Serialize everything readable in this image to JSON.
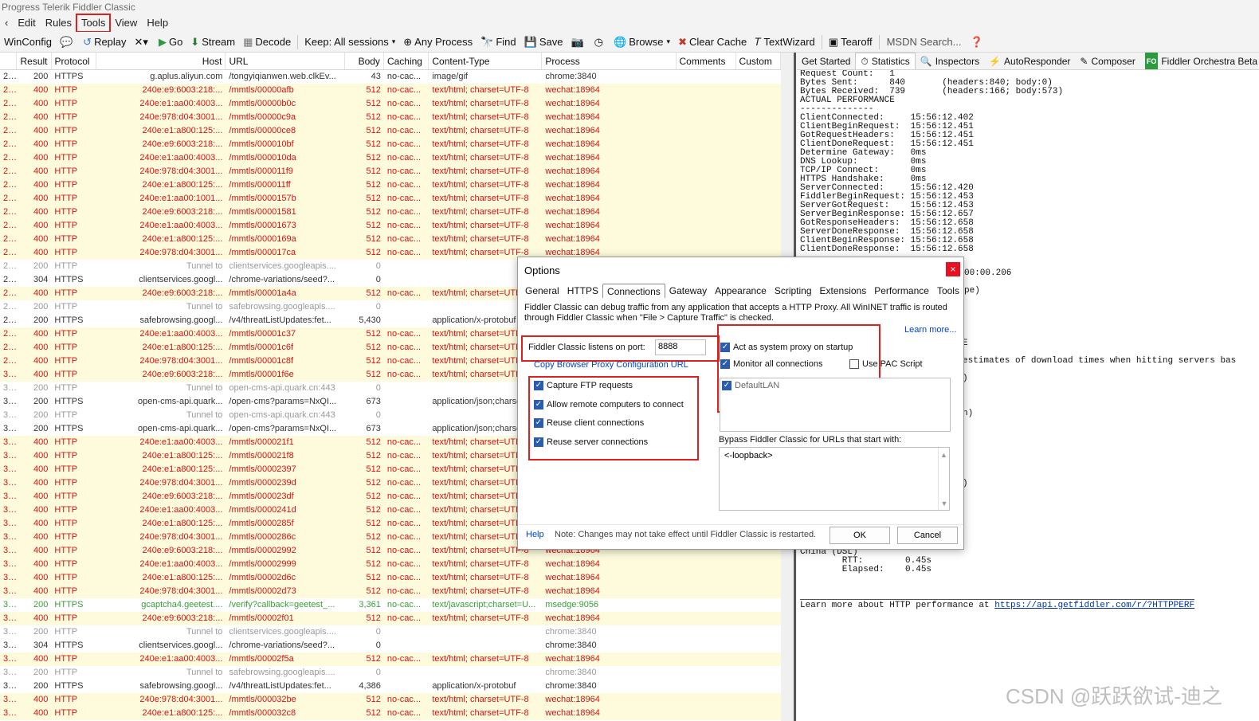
{
  "window": {
    "title": "Progress Telerik Fiddler Classic"
  },
  "menu": [
    "Edit",
    "Rules",
    "Tools",
    "View",
    "Help"
  ],
  "toolbar": {
    "winconfig": "WinConfig",
    "replay": "Replay",
    "go": "Go",
    "stream": "Stream",
    "decode": "Decode",
    "keep": "Keep: All sessions",
    "any_process": "Any Process",
    "find": "Find",
    "save": "Save",
    "browse": "Browse",
    "clear_cache": "Clear Cache",
    "textwizard": "TextWizard",
    "tearoff": "Tearoff",
    "search_placeholder": "MSDN Search..."
  },
  "sessions": {
    "columns": [
      "Result",
      "Protocol",
      "Host",
      "URL",
      "Body",
      "Caching",
      "Content-Type",
      "Process",
      "Comments",
      "Custom"
    ],
    "rows": [
      {
        "id": "2...",
        "result": "200",
        "protocol": "HTTPS",
        "host": "g.aplus.aliyun.com",
        "url": "/tongyiqianwen.web.clkEv...",
        "body": "43",
        "caching": "no-cac...",
        "type": "image/gif",
        "process": "chrome:3840",
        "kind": "ok"
      },
      {
        "id": "2...",
        "result": "400",
        "protocol": "HTTP",
        "host": "240e:e9:6003:218:...",
        "url": "/mmtls/00000afb",
        "body": "512",
        "caching": "no-cac...",
        "type": "text/html; charset=UTF-8",
        "process": "wechat:18964",
        "kind": "err"
      },
      {
        "id": "2...",
        "result": "400",
        "protocol": "HTTP",
        "host": "240e:e1:aa00:4003...",
        "url": "/mmtls/00000b0c",
        "body": "512",
        "caching": "no-cac...",
        "type": "text/html; charset=UTF-8",
        "process": "wechat:18964",
        "kind": "err"
      },
      {
        "id": "2...",
        "result": "400",
        "protocol": "HTTP",
        "host": "240e:978:d04:3001...",
        "url": "/mmtls/00000c9a",
        "body": "512",
        "caching": "no-cac...",
        "type": "text/html; charset=UTF-8",
        "process": "wechat:18964",
        "kind": "err"
      },
      {
        "id": "2...",
        "result": "400",
        "protocol": "HTTP",
        "host": "240e:e1:a800:125:...",
        "url": "/mmtls/00000ce8",
        "body": "512",
        "caching": "no-cac...",
        "type": "text/html; charset=UTF-8",
        "process": "wechat:18964",
        "kind": "err"
      },
      {
        "id": "2...",
        "result": "400",
        "protocol": "HTTP",
        "host": "240e:e9:6003:218:...",
        "url": "/mmtls/000010bf",
        "body": "512",
        "caching": "no-cac...",
        "type": "text/html; charset=UTF-8",
        "process": "wechat:18964",
        "kind": "err"
      },
      {
        "id": "2...",
        "result": "400",
        "protocol": "HTTP",
        "host": "240e:e1:aa00:4003...",
        "url": "/mmtls/000010da",
        "body": "512",
        "caching": "no-cac...",
        "type": "text/html; charset=UTF-8",
        "process": "wechat:18964",
        "kind": "err"
      },
      {
        "id": "2...",
        "result": "400",
        "protocol": "HTTP",
        "host": "240e:978:d04:3001...",
        "url": "/mmtls/000011f9",
        "body": "512",
        "caching": "no-cac...",
        "type": "text/html; charset=UTF-8",
        "process": "wechat:18964",
        "kind": "err"
      },
      {
        "id": "2...",
        "result": "400",
        "protocol": "HTTP",
        "host": "240e:e1:a800:125:...",
        "url": "/mmtls/000011ff",
        "body": "512",
        "caching": "no-cac...",
        "type": "text/html; charset=UTF-8",
        "process": "wechat:18964",
        "kind": "err"
      },
      {
        "id": "2...",
        "result": "400",
        "protocol": "HTTP",
        "host": "240e:e1:aa00:1001...",
        "url": "/mmtls/0000157b",
        "body": "512",
        "caching": "no-cac...",
        "type": "text/html; charset=UTF-8",
        "process": "wechat:18964",
        "kind": "err"
      },
      {
        "id": "2...",
        "result": "400",
        "protocol": "HTTP",
        "host": "240e:e9:6003:218:...",
        "url": "/mmtls/00001581",
        "body": "512",
        "caching": "no-cac...",
        "type": "text/html; charset=UTF-8",
        "process": "wechat:18964",
        "kind": "err"
      },
      {
        "id": "2...",
        "result": "400",
        "protocol": "HTTP",
        "host": "240e:e1:aa00:4003...",
        "url": "/mmtls/00001673",
        "body": "512",
        "caching": "no-cac...",
        "type": "text/html; charset=UTF-8",
        "process": "wechat:18964",
        "kind": "err"
      },
      {
        "id": "2...",
        "result": "400",
        "protocol": "HTTP",
        "host": "240e:e1:a800:125:...",
        "url": "/mmtls/0000169a",
        "body": "512",
        "caching": "no-cac...",
        "type": "text/html; charset=UTF-8",
        "process": "wechat:18964",
        "kind": "err"
      },
      {
        "id": "2...",
        "result": "400",
        "protocol": "HTTP",
        "host": "240e:978:d04:3001...",
        "url": "/mmtls/000017ca",
        "body": "512",
        "caching": "no-cac...",
        "type": "text/html; charset=UTF-8",
        "process": "wechat:18964",
        "kind": "err"
      },
      {
        "id": "2...",
        "result": "200",
        "protocol": "HTTP",
        "host": "Tunnel to",
        "url": "clientservices.googleapis....",
        "body": "0",
        "caching": "",
        "type": "",
        "process": "",
        "kind": "tunnel"
      },
      {
        "id": "2...",
        "result": "304",
        "protocol": "HTTPS",
        "host": "clientservices.googl...",
        "url": "/chrome-variations/seed?...",
        "body": "0",
        "caching": "",
        "type": "",
        "process": "",
        "kind": "ok"
      },
      {
        "id": "2...",
        "result": "400",
        "protocol": "HTTP",
        "host": "240e:e9:6003:218:...",
        "url": "/mmtls/00001a4a",
        "body": "512",
        "caching": "no-cac...",
        "type": "text/html; charset=UTF-8",
        "process": "",
        "kind": "err"
      },
      {
        "id": "2...",
        "result": "200",
        "protocol": "HTTP",
        "host": "Tunnel to",
        "url": "safebrowsing.googleapis....",
        "body": "0",
        "caching": "",
        "type": "",
        "process": "",
        "kind": "tunnel"
      },
      {
        "id": "2...",
        "result": "200",
        "protocol": "HTTPS",
        "host": "safebrowsing.googl...",
        "url": "/v4/threatListUpdates:fet...",
        "body": "5,430",
        "caching": "",
        "type": "application/x-protobuf",
        "process": "",
        "kind": "ok"
      },
      {
        "id": "2...",
        "result": "400",
        "protocol": "HTTP",
        "host": "240e:e1:aa00:4003...",
        "url": "/mmtls/00001c37",
        "body": "512",
        "caching": "no-cac...",
        "type": "text/html; charset=UTF-8",
        "process": "",
        "kind": "err"
      },
      {
        "id": "2...",
        "result": "400",
        "protocol": "HTTP",
        "host": "240e:e1:a800:125:...",
        "url": "/mmtls/00001c6f",
        "body": "512",
        "caching": "no-cac...",
        "type": "text/html; charset=UTF-8",
        "process": "",
        "kind": "err"
      },
      {
        "id": "2...",
        "result": "400",
        "protocol": "HTTP",
        "host": "240e:978:d04:3001...",
        "url": "/mmtls/00001c8f",
        "body": "512",
        "caching": "no-cac...",
        "type": "text/html; charset=UTF-8",
        "process": "",
        "kind": "err"
      },
      {
        "id": "3...",
        "result": "400",
        "protocol": "HTTP",
        "host": "240e:e9:6003:218:...",
        "url": "/mmtls/00001f6e",
        "body": "512",
        "caching": "no-cac...",
        "type": "text/html; charset=UTF-8",
        "process": "",
        "kind": "err"
      },
      {
        "id": "3...",
        "result": "200",
        "protocol": "HTTP",
        "host": "Tunnel to",
        "url": "open-cms-api.quark.cn:443",
        "body": "0",
        "caching": "",
        "type": "",
        "process": "",
        "kind": "tunnel"
      },
      {
        "id": "3...",
        "result": "200",
        "protocol": "HTTPS",
        "host": "open-cms-api.quark...",
        "url": "/open-cms?params=NxQI...",
        "body": "673",
        "caching": "",
        "type": "application/json;charset=U...",
        "process": "",
        "kind": "ok"
      },
      {
        "id": "3...",
        "result": "200",
        "protocol": "HTTP",
        "host": "Tunnel to",
        "url": "open-cms-api.quark.cn:443",
        "body": "0",
        "caching": "",
        "type": "",
        "process": "",
        "kind": "tunnel"
      },
      {
        "id": "3...",
        "result": "200",
        "protocol": "HTTPS",
        "host": "open-cms-api.quark...",
        "url": "/open-cms?params=NxQI...",
        "body": "673",
        "caching": "",
        "type": "application/json;charset=U...",
        "process": "",
        "kind": "ok"
      },
      {
        "id": "3...",
        "result": "400",
        "protocol": "HTTP",
        "host": "240e:e1:aa00:4003...",
        "url": "/mmtls/000021f1",
        "body": "512",
        "caching": "no-cac...",
        "type": "text/html; charset=UTF-8",
        "process": "",
        "kind": "err"
      },
      {
        "id": "3...",
        "result": "400",
        "protocol": "HTTP",
        "host": "240e:e1:a800:125:...",
        "url": "/mmtls/000021f8",
        "body": "512",
        "caching": "no-cac...",
        "type": "text/html; charset=UTF-8",
        "process": "",
        "kind": "err"
      },
      {
        "id": "3...",
        "result": "400",
        "protocol": "HTTP",
        "host": "240e:e1:a800:125:...",
        "url": "/mmtls/00002397",
        "body": "512",
        "caching": "no-cac...",
        "type": "text/html; charset=UTF-8",
        "process": "",
        "kind": "err"
      },
      {
        "id": "3...",
        "result": "400",
        "protocol": "HTTP",
        "host": "240e:978:d04:3001...",
        "url": "/mmtls/0000239d",
        "body": "512",
        "caching": "no-cac...",
        "type": "text/html; charset=UTF-8",
        "process": "",
        "kind": "err"
      },
      {
        "id": "3...",
        "result": "400",
        "protocol": "HTTP",
        "host": "240e:e9:6003:218:...",
        "url": "/mmtls/000023df",
        "body": "512",
        "caching": "no-cac...",
        "type": "text/html; charset=UTF-8",
        "process": "",
        "kind": "err"
      },
      {
        "id": "3...",
        "result": "400",
        "protocol": "HTTP",
        "host": "240e:e1:aa00:4003...",
        "url": "/mmtls/0000241d",
        "body": "512",
        "caching": "no-cac...",
        "type": "text/html; charset=UTF-8",
        "process": "",
        "kind": "err"
      },
      {
        "id": "3...",
        "result": "400",
        "protocol": "HTTP",
        "host": "240e:e1:a800:125:...",
        "url": "/mmtls/0000285f",
        "body": "512",
        "caching": "no-cac...",
        "type": "text/html; charset=UTF-8",
        "process": "",
        "kind": "err"
      },
      {
        "id": "3...",
        "result": "400",
        "protocol": "HTTP",
        "host": "240e:978:d04:3001...",
        "url": "/mmtls/0000286c",
        "body": "512",
        "caching": "no-cac...",
        "type": "text/html; charset=UTF-8",
        "process": "wechat:18964",
        "kind": "err"
      },
      {
        "id": "3...",
        "result": "400",
        "protocol": "HTTP",
        "host": "240e:e9:6003:218:...",
        "url": "/mmtls/00002992",
        "body": "512",
        "caching": "no-cac...",
        "type": "text/html; charset=UTF-8",
        "process": "wechat:18964",
        "kind": "err"
      },
      {
        "id": "3...",
        "result": "400",
        "protocol": "HTTP",
        "host": "240e:e1:aa00:4003...",
        "url": "/mmtls/00002999",
        "body": "512",
        "caching": "no-cac...",
        "type": "text/html; charset=UTF-8",
        "process": "wechat:18964",
        "kind": "err"
      },
      {
        "id": "3...",
        "result": "400",
        "protocol": "HTTP",
        "host": "240e:e1:a800:125:...",
        "url": "/mmtls/00002d6c",
        "body": "512",
        "caching": "no-cac...",
        "type": "text/html; charset=UTF-8",
        "process": "wechat:18964",
        "kind": "err"
      },
      {
        "id": "3...",
        "result": "400",
        "protocol": "HTTP",
        "host": "240e:978:d04:3001...",
        "url": "/mmtls/00002d73",
        "body": "512",
        "caching": "no-cac...",
        "type": "text/html; charset=UTF-8",
        "process": "wechat:18964",
        "kind": "err"
      },
      {
        "id": "3...",
        "result": "200",
        "protocol": "HTTPS",
        "host": "gcaptcha4.geetest....",
        "url": "/verify?callback=geetest_...",
        "body": "3,361",
        "caching": "no-cac...",
        "type": "text/javascript;charset=U...",
        "process": "msedge:9056",
        "kind": "green"
      },
      {
        "id": "3...",
        "result": "400",
        "protocol": "HTTP",
        "host": "240e:e9:6003:218:...",
        "url": "/mmtls/00002f01",
        "body": "512",
        "caching": "no-cac...",
        "type": "text/html; charset=UTF-8",
        "process": "wechat:18964",
        "kind": "err"
      },
      {
        "id": "3...",
        "result": "200",
        "protocol": "HTTP",
        "host": "Tunnel to",
        "url": "clientservices.googleapis....",
        "body": "0",
        "caching": "",
        "type": "",
        "process": "chrome:3840",
        "kind": "tunnel"
      },
      {
        "id": "3...",
        "result": "304",
        "protocol": "HTTPS",
        "host": "clientservices.googl...",
        "url": "/chrome-variations/seed?...",
        "body": "0",
        "caching": "",
        "type": "",
        "process": "chrome:3840",
        "kind": "ok"
      },
      {
        "id": "3...",
        "result": "400",
        "protocol": "HTTP",
        "host": "240e:e1:aa00:4003...",
        "url": "/mmtls/00002f5a",
        "body": "512",
        "caching": "no-cac...",
        "type": "text/html; charset=UTF-8",
        "process": "wechat:18964",
        "kind": "err"
      },
      {
        "id": "3...",
        "result": "200",
        "protocol": "HTTP",
        "host": "Tunnel to",
        "url": "safebrowsing.googleapis....",
        "body": "0",
        "caching": "",
        "type": "",
        "process": "chrome:3840",
        "kind": "tunnel"
      },
      {
        "id": "3...",
        "result": "200",
        "protocol": "HTTPS",
        "host": "safebrowsing.googl...",
        "url": "/v4/threatListUpdates:fet...",
        "body": "4,386",
        "caching": "",
        "type": "application/x-protobuf",
        "process": "chrome:3840",
        "kind": "ok"
      },
      {
        "id": "3...",
        "result": "400",
        "protocol": "HTTP",
        "host": "240e:978:d04:3001...",
        "url": "/mmtls/000032be",
        "body": "512",
        "caching": "no-cac...",
        "type": "text/html; charset=UTF-8",
        "process": "wechat:18964",
        "kind": "err"
      },
      {
        "id": "3...",
        "result": "400",
        "protocol": "HTTP",
        "host": "240e:e1:a800:125:...",
        "url": "/mmtls/000032c8",
        "body": "512",
        "caching": "no-cac...",
        "type": "text/html; charset=UTF-8",
        "process": "wechat:18964",
        "kind": "err"
      }
    ]
  },
  "inspector_tabs": [
    "Get Started",
    "Statistics",
    "Inspectors",
    "AutoResponder",
    "Composer",
    "Fiddler Orchestra Beta"
  ],
  "stats": {
    "lines": [
      "Request Count:   1",
      "Bytes Sent:      840       (headers:840; body:0)",
      "Bytes Received:  739       (headers:166; body:573)",
      "",
      "ACTUAL PERFORMANCE",
      "--------------",
      "ClientConnected:     15:56:12.402",
      "ClientBeginRequest:  15:56:12.451",
      "GotRequestHeaders:   15:56:12.451",
      "ClientDoneRequest:   15:56:12.451",
      "Determine Gateway:   0ms",
      "DNS Lookup:          0ms",
      "TCP/IP Connect:      0ms",
      "HTTPS Handshake:     0ms",
      "ServerConnected:     15:56:12.420",
      "FiddlerBeginRequest: 15:56:12.453",
      "ServerGotRequest:    15:56:12.453",
      "ServerBeginResponse: 15:56:12.657",
      "GotResponseHeaders:  15:56:12.658",
      "ServerDoneResponse:  15:56:12.658",
      "ClientBeginResponse: 15:56:12.658",
      "ClientDoneResponse:  15:56:12.658"
    ],
    "partial": [
      "00:00.206",
      "pe)",
      "E",
      "estimates of download times when hitting servers bas",
      ")",
      "n)",
      ")"
    ],
    "china": [
      "China (DSL)",
      "        RTT:        0.45s",
      "        Elapsed:    0.45s"
    ],
    "footer_text": "Learn more about HTTP performance at ",
    "footer_link": "https://api.getfiddler.com/r/?HTTPPERF"
  },
  "dialog": {
    "title": "Options",
    "close": "×",
    "tabs": [
      "General",
      "HTTPS",
      "Connections",
      "Gateway",
      "Appearance",
      "Scripting",
      "Extensions",
      "Performance",
      "Tools"
    ],
    "description": "Fiddler Classic can debug traffic from any application that accepts a HTTP Proxy. All WinINET traffic is routed through Fiddler Classic when \"File > Capture Traffic\" is checked.",
    "learn_more": "Learn more...",
    "port_label": "Fiddler Classic listens on port:",
    "port_value": "8888",
    "copy_link": "Copy Browser Proxy Configuration URL",
    "left_checks": [
      "Capture FTP requests",
      "Allow remote computers to connect",
      "Reuse client connections",
      "Reuse server connections"
    ],
    "act_system_proxy": "Act as system proxy on startup",
    "monitor_all": "Monitor all connections",
    "use_pac": "Use PAC Script",
    "lan_item": "DefaultLAN",
    "bypass_label": "Bypass Fiddler Classic for URLs that start with:",
    "bypass_value": "<-loopback>",
    "help": "Help",
    "note": "Note: Changes may not take effect until Fiddler Classic is restarted.",
    "ok": "OK",
    "cancel": "Cancel"
  },
  "watermark": "CSDN @跃跃欲试-迪之",
  "colors": {
    "error_red": "#d41212",
    "error_row_bg": "#fdfbdc",
    "highlight_red": "#e0201e",
    "checkbox_blue": "#2a5cb0"
  }
}
